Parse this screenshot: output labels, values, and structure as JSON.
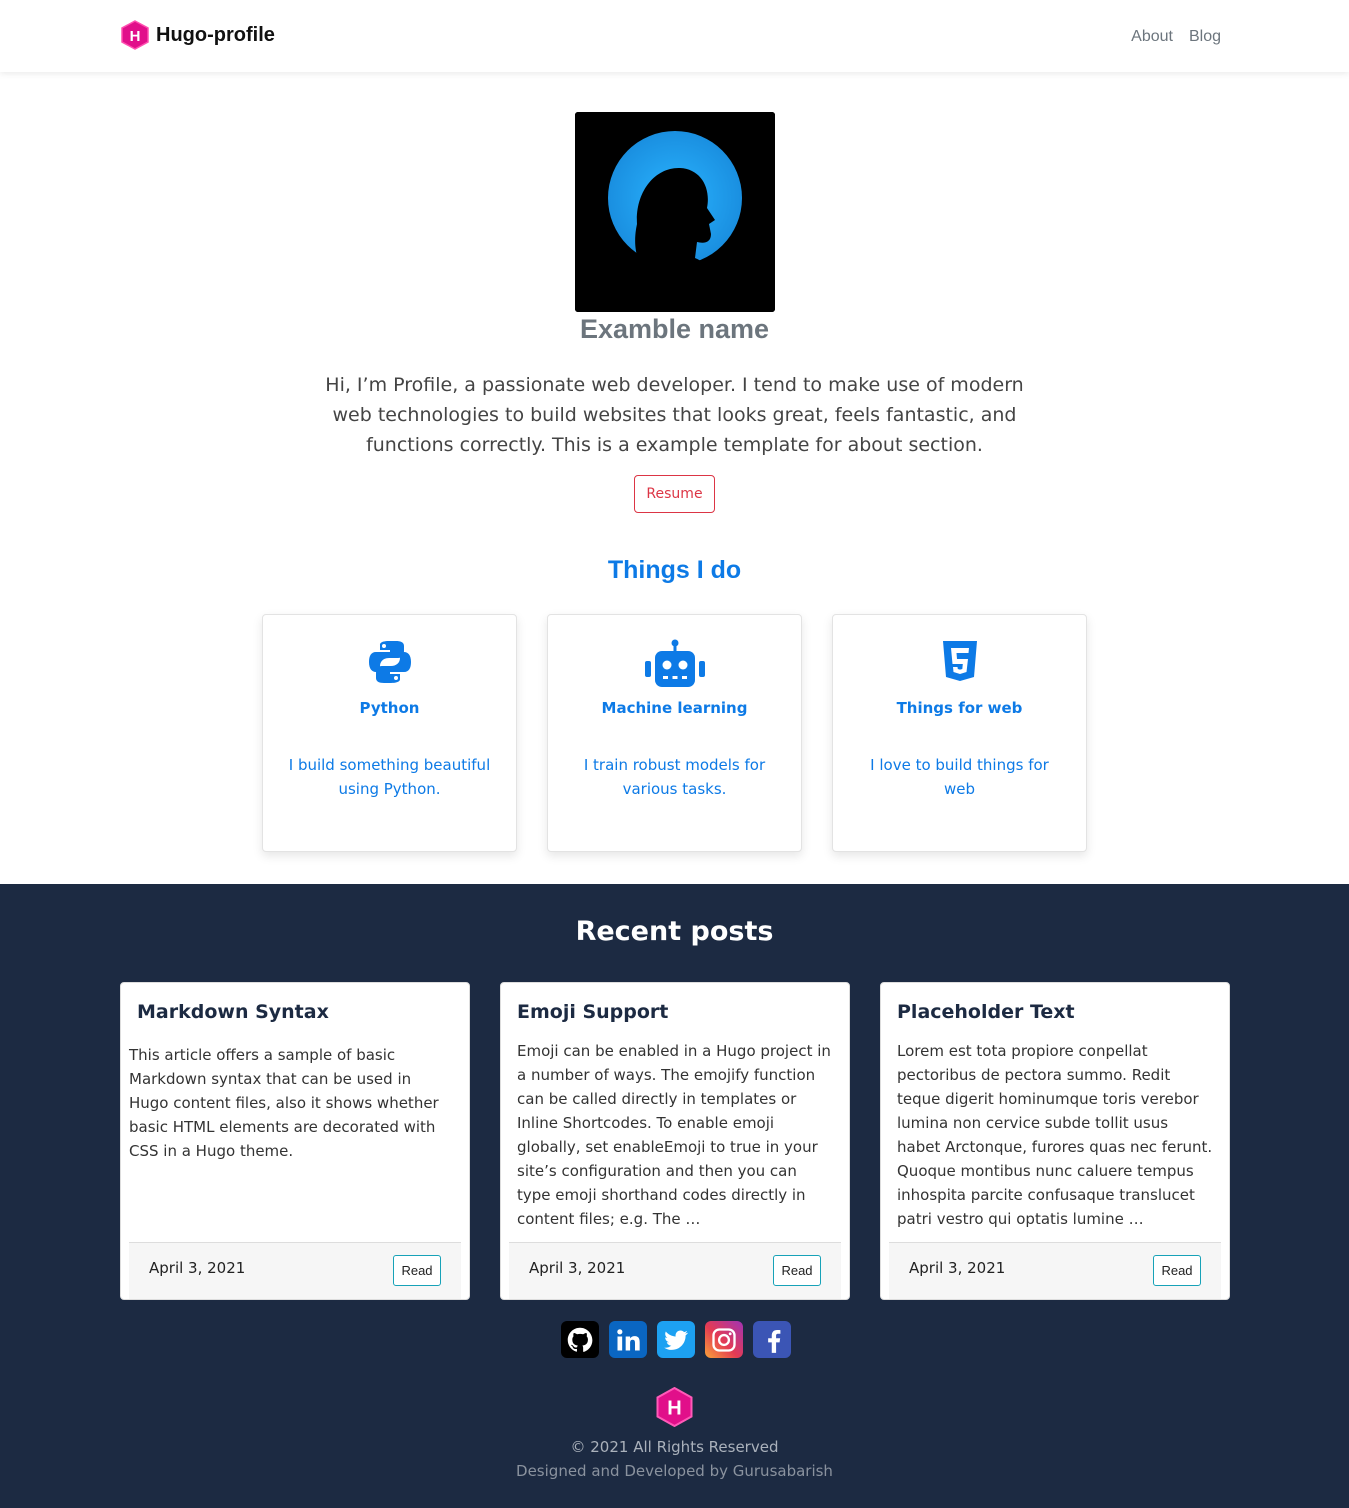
{
  "navbar": {
    "brand": "Hugo-profile",
    "links": [
      "About",
      "Blog"
    ]
  },
  "profile": {
    "name": "Examble name",
    "bio": "Hi, I’m Profile, a passionate web developer. I tend to make use of modern web technologies to build websites that looks great, feels fantastic, and functions correctly. This is a example template for about section.",
    "resume_label": "Resume"
  },
  "things": {
    "title": "Things I do",
    "items": [
      {
        "icon": "python-icon",
        "title": "Python",
        "desc": "I build something beautiful using Python."
      },
      {
        "icon": "robot-icon",
        "title": "Machine learning",
        "desc": "I train robust models for various tasks."
      },
      {
        "icon": "html5-icon",
        "title": "Things for web",
        "desc": "I love to build things for web"
      }
    ]
  },
  "posts": {
    "title": "Recent posts",
    "items": [
      {
        "title": "Markdown Syntax",
        "body": "This article offers a sample of basic Markdown syntax that can be used in Hugo content files, also it shows whether basic HTML elements are decorated with CSS in a Hugo theme.",
        "date": "April 3, 2021",
        "read": "Read"
      },
      {
        "title": "Emoji Support",
        "body": "Emoji can be enabled in a Hugo project in a number of ways. The emojify function can be called directly in templates or Inline Shortcodes. To enable emoji globally, set enableEmoji to true in your site’s configuration and then you can type emoji shorthand codes directly in content files; e.g. The …",
        "date": "April 3, 2021",
        "read": "Read"
      },
      {
        "title": "Placeholder Text",
        "body": "Lorem est tota propiore conpellat pectoribus de pectora summo. Redit teque digerit hominumque toris verebor lumina non cervice subde tollit usus habet Arctonque, furores quas nec ferunt. Quoque montibus nunc caluere tempus inhospita parcite confusaque translucet patri vestro qui optatis lumine …",
        "date": "April 3, 2021",
        "read": "Read"
      }
    ]
  },
  "social": [
    "github-icon",
    "linkedin-icon",
    "twitter-icon",
    "instagram-icon",
    "facebook-icon"
  ],
  "footer": {
    "copyright": "© 2021 All Rights Reserved",
    "designed": "Designed and Developed by Gurusabarish"
  },
  "colors": {
    "accent": "#0d7ae6",
    "hugo_pink": "#e10f8a",
    "dark_bg": "#1c2a42",
    "danger": "#dc3545"
  }
}
